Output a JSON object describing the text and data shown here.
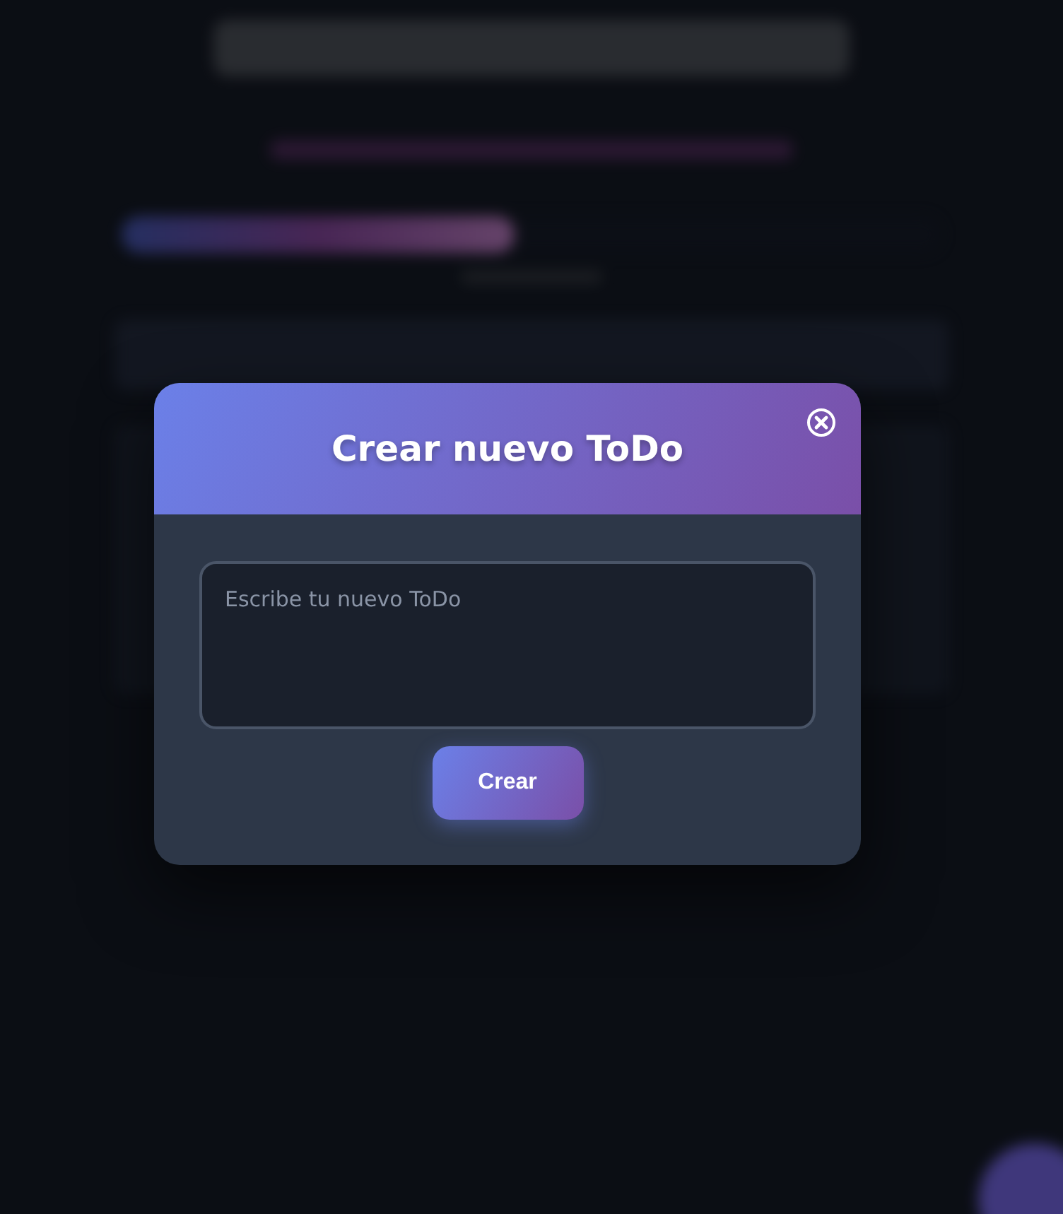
{
  "backdrop": {
    "progress": {
      "level": 0.48
    }
  },
  "modal": {
    "title": "Crear nuevo ToDo",
    "input": {
      "placeholder": "Escribe tu nuevo ToDo"
    },
    "submit_button": {
      "label": "Crear"
    }
  }
}
